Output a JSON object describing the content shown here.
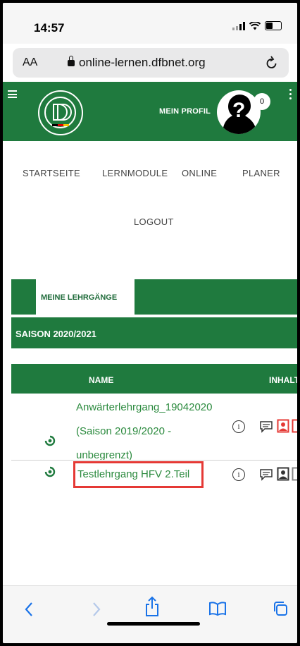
{
  "status_bar": {
    "time": "14:57"
  },
  "browser": {
    "aa_label": "AA",
    "url": "online-lernen.dfbnet.org"
  },
  "header": {
    "profile_label": "MEIN PROFIL",
    "notification_count": "0"
  },
  "nav": {
    "items": [
      "STARTSEITE",
      "LERNMODULE",
      "ONLINE",
      "PLANER"
    ],
    "logout": "LOGOUT"
  },
  "tabs": {
    "active": "MEINE LEHRGÄNGE"
  },
  "season": {
    "label": "SAISON 2020/2021"
  },
  "table": {
    "columns": [
      "NAME",
      "INHALT"
    ],
    "rows": [
      {
        "line1": "Anwärterlehrgang_19042020",
        "line2": "(Saison 2019/2020 -",
        "line3": "unbegrenzt)"
      },
      {
        "line1": "Testlehrgang HFV 2.Teil"
      }
    ]
  },
  "colors": {
    "brand_green": "#1f7a3e",
    "link_green": "#2b8a3e",
    "highlight_red": "#e53935",
    "ios_blue": "#1a73e8"
  }
}
